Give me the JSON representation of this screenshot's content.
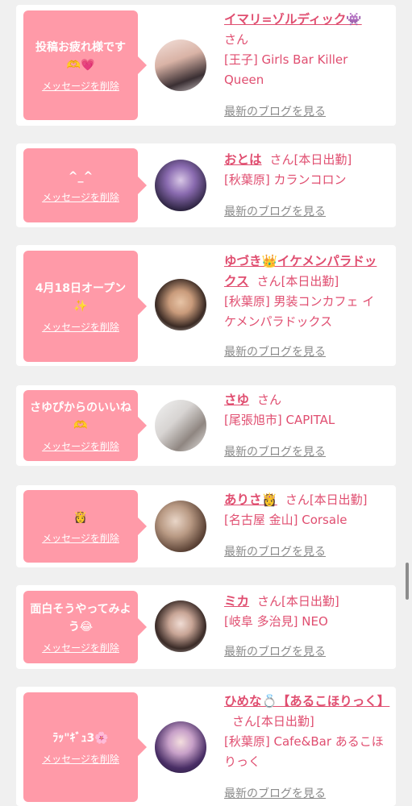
{
  "delete_label": "メッセージを削除",
  "blog_label": "最新のブログを見る",
  "san": "さん",
  "entries": [
    {
      "message": "投稿お疲れ様です🫶💗",
      "name": "イマリ=ゾルディック👾",
      "status": "",
      "shop": "[王子] Girls Bar Killer Queen"
    },
    {
      "message": "^_^",
      "name": "おとは",
      "status": "[本日出勤]",
      "shop": "[秋葉原] カランコロン"
    },
    {
      "message": "4月18日オープン✨",
      "name": "ゆづき👑イケメンパラドックス",
      "status": "[本日出勤]",
      "shop": "[秋葉原] 男装コンカフェ イケメンパラドックス"
    },
    {
      "message": "さゆぴからのいいね🫶",
      "name": "さゆ",
      "status": "",
      "shop": "[尾張旭市] CAPITAL"
    },
    {
      "message": "👸",
      "name": "ありさ👸",
      "status": "[本日出勤]",
      "shop": "[名古屋 金山] Corsale"
    },
    {
      "message": "面白そうやってみよう😂",
      "name": "ミカ",
      "status": "[本日出勤]",
      "shop": "[岐阜 多治見] NEO"
    },
    {
      "message": "ﾗｯ\"ｷﾞｭ3🌸",
      "name": "ひめな💍【あるこほりっく】",
      "status": "[本日出勤]",
      "shop": "[秋葉原] Cafe&Bar あるこほりっく"
    }
  ],
  "colors": {
    "accent": "#e04e70",
    "bubble": "#ff9aa8",
    "background": "#f0f0f0"
  }
}
